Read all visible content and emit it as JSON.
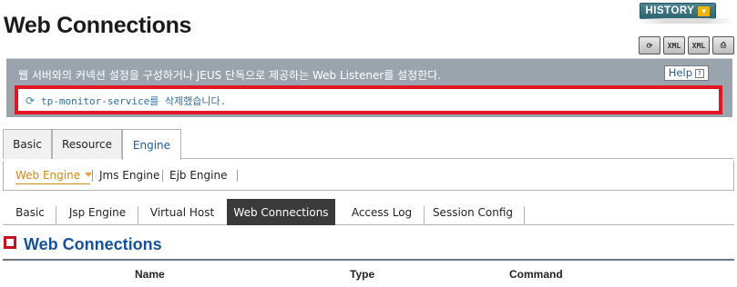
{
  "page": {
    "title": "Web Connections"
  },
  "history": {
    "label": "HISTORY"
  },
  "tools": [
    {
      "name": "reload-icon",
      "glyph": "⟳"
    },
    {
      "name": "xml-export-icon",
      "glyph": "XML"
    },
    {
      "name": "xml-import-icon",
      "glyph": "XML"
    },
    {
      "name": "print-icon",
      "glyph": "⎙"
    }
  ],
  "info": {
    "description": "웹 서버와의 커넥션 설정을 구성하거나 JEUS 단독으로 제공하는 Web Listener를 설정한다.",
    "help_label": "Help",
    "message": "tp-monitor-service를 삭제했습니다."
  },
  "main_tabs": [
    {
      "label": "Basic"
    },
    {
      "label": "Resource"
    },
    {
      "label": "Engine",
      "active": true
    }
  ],
  "engine_tabs": [
    {
      "label": "Web Engine",
      "active": true
    },
    {
      "label": "Jms Engine"
    },
    {
      "label": "Ejb Engine"
    }
  ],
  "web_tabs": [
    {
      "label": "Basic"
    },
    {
      "label": "Jsp Engine"
    },
    {
      "label": "Virtual Host"
    },
    {
      "label": "Web Connections",
      "active": true
    },
    {
      "label": "Access Log"
    },
    {
      "label": "Session Config"
    }
  ],
  "section": {
    "title": "Web Connections"
  },
  "table": {
    "columns": [
      "Name",
      "Type",
      "Command"
    ]
  },
  "colors": {
    "accent_blue": "#16529a",
    "alert_red": "#e11524",
    "active_orange": "#d68918",
    "active_tab_dark": "#3a3a3a",
    "panel_gray": "#9aa4ad"
  }
}
